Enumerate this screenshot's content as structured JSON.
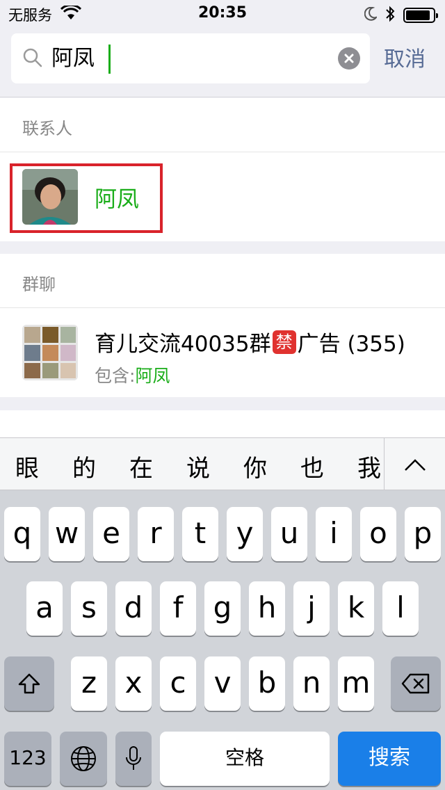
{
  "status_bar": {
    "carrier": "无服务",
    "time": "20:35",
    "battery_level": 0.9,
    "icons": [
      "wifi-icon",
      "moon-icon",
      "bluetooth-icon",
      "battery-icon"
    ]
  },
  "search": {
    "query": "阿凤",
    "cancel_label": "取消"
  },
  "contacts_section": {
    "title": "联系人",
    "items": [
      {
        "name": "阿凤"
      }
    ]
  },
  "groups_section": {
    "title": "群聊",
    "items": [
      {
        "name_prefix": "育儿交流40035群",
        "badge": "禁",
        "name_suffix": "广告 (355)",
        "sub_prefix": "包含:",
        "sub_match": "阿凤"
      }
    ]
  },
  "candidates": {
    "items": [
      "眼",
      "的",
      "在",
      "说",
      "你",
      "也",
      "我"
    ]
  },
  "keyboard": {
    "row1": [
      "q",
      "w",
      "e",
      "r",
      "t",
      "y",
      "u",
      "i",
      "o",
      "p"
    ],
    "row2": [
      "a",
      "s",
      "d",
      "f",
      "g",
      "h",
      "j",
      "k",
      "l"
    ],
    "row3": [
      "z",
      "x",
      "c",
      "v",
      "b",
      "n",
      "m"
    ],
    "numbers_label": "123",
    "space_label": "空格",
    "search_label": "搜索"
  },
  "colors": {
    "accent_green": "#1aad19",
    "link_blue": "#576b95",
    "highlight_red": "#d9232b",
    "search_key_blue": "#1a7fe8"
  }
}
